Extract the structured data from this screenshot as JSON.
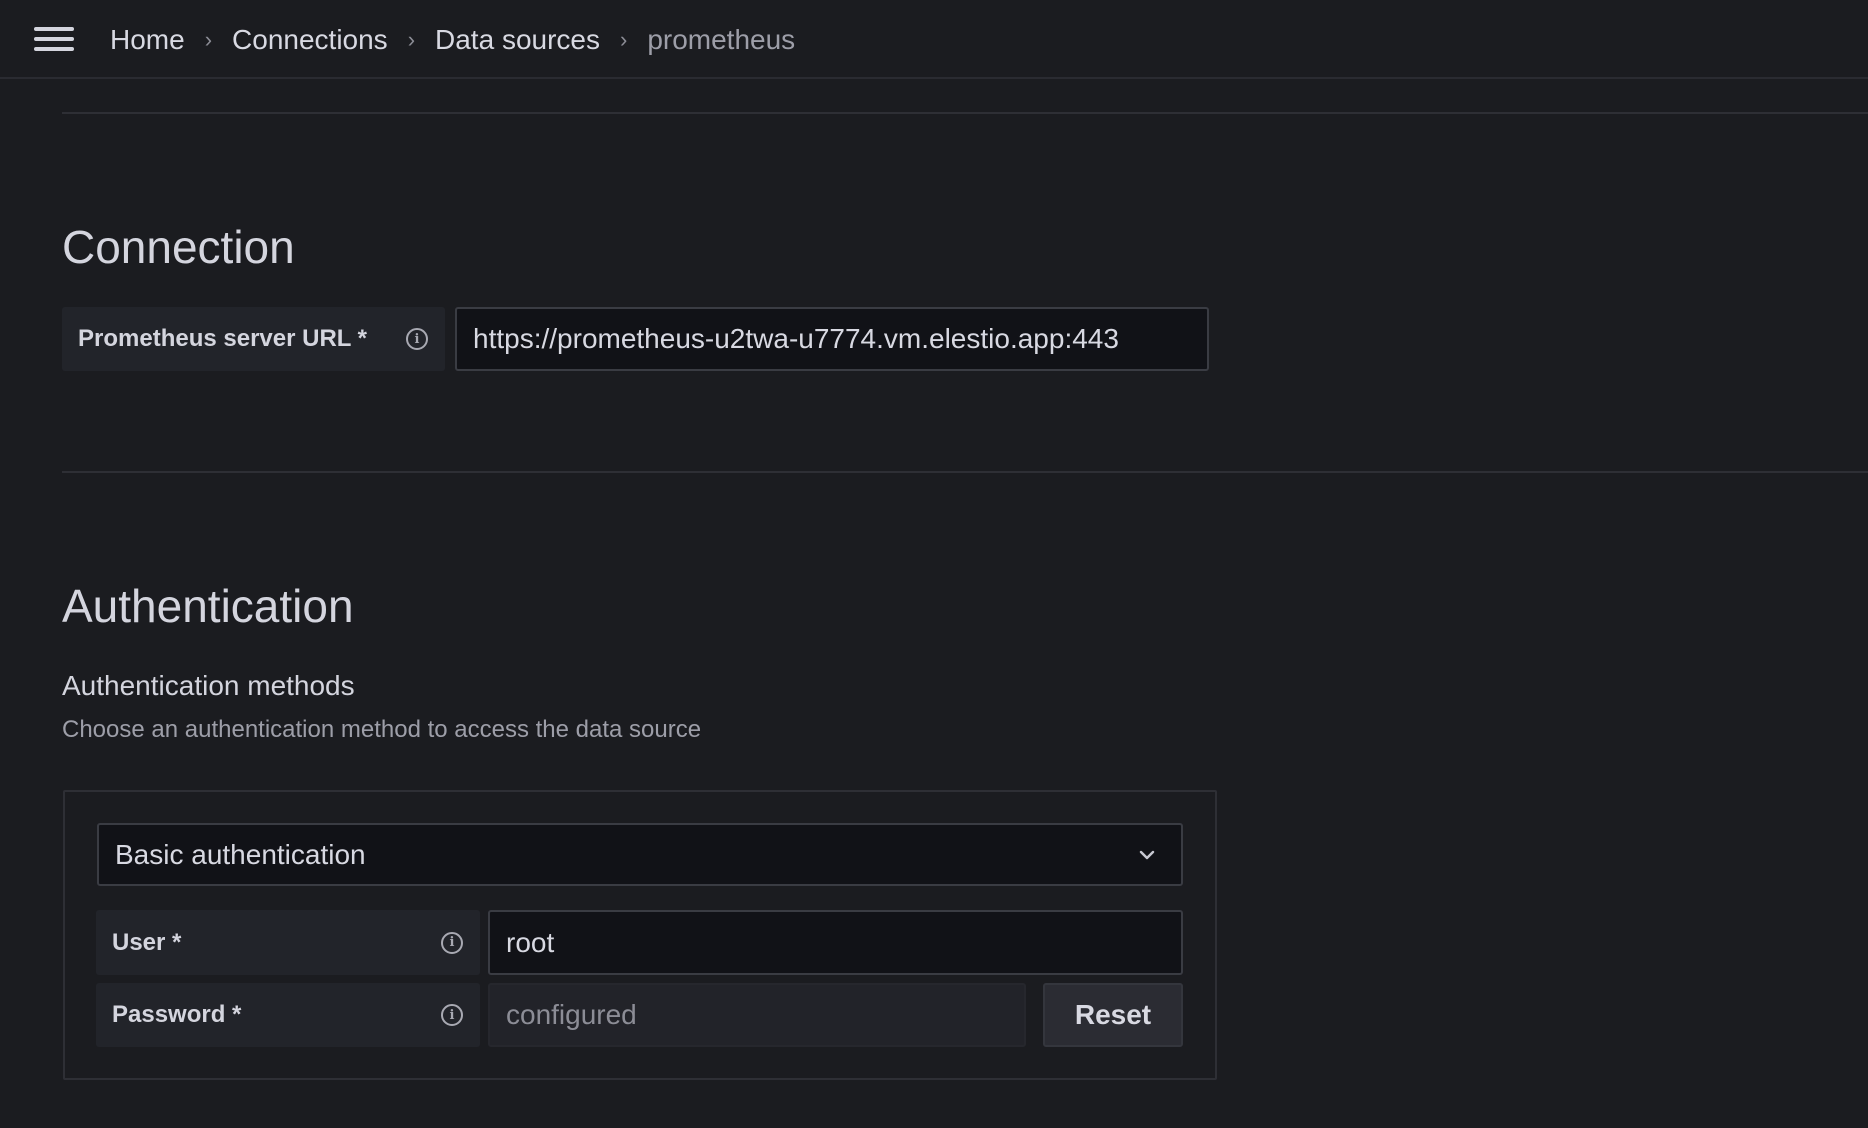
{
  "header": {
    "menu_icon": "hamburger-menu-icon",
    "breadcrumb": [
      {
        "label": "Home"
      },
      {
        "label": "Connections"
      },
      {
        "label": "Data sources"
      },
      {
        "label": "prometheus"
      }
    ],
    "separator": "›"
  },
  "connection": {
    "heading": "Connection",
    "server_url": {
      "label": "Prometheus server URL *",
      "info_icon": "info-icon",
      "value": "https://prometheus-u2twa-u7774.vm.elestio.app:443"
    }
  },
  "authentication": {
    "heading": "Authentication",
    "methods_title": "Authentication methods",
    "methods_description": "Choose an authentication method to access the data source",
    "method_select": {
      "value": "Basic authentication",
      "icon": "chevron-down-icon"
    },
    "user": {
      "label": "User *",
      "info_icon": "info-icon",
      "value": "root"
    },
    "password": {
      "label": "Password *",
      "info_icon": "info-icon",
      "value": "configured",
      "reset_label": "Reset"
    }
  }
}
